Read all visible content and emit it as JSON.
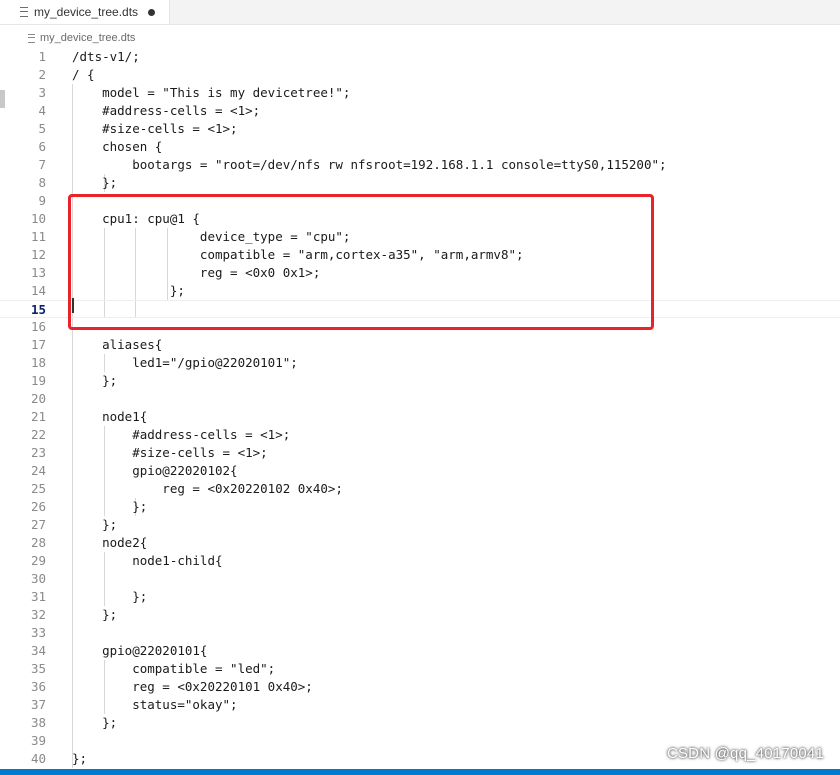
{
  "tab": {
    "filename": "my_device_tree.dts"
  },
  "breadcrumb": {
    "filename": "my_device_tree.dts"
  },
  "editor": {
    "current_line": 15,
    "lines": [
      {
        "num": "1",
        "text": "/dts-v1/;"
      },
      {
        "num": "2",
        "text": "/ {"
      },
      {
        "num": "3",
        "text": "    model = \"This is my devicetree!\";"
      },
      {
        "num": "4",
        "text": "    #address-cells = <1>;"
      },
      {
        "num": "5",
        "text": "    #size-cells = <1>;"
      },
      {
        "num": "6",
        "text": "    chosen {"
      },
      {
        "num": "7",
        "text": "        bootargs = \"root=/dev/nfs rw nfsroot=192.168.1.1 console=ttyS0,115200\";"
      },
      {
        "num": "8",
        "text": "    };"
      },
      {
        "num": "9",
        "text": ""
      },
      {
        "num": "10",
        "text": "    cpu1: cpu@1 {"
      },
      {
        "num": "11",
        "text": "                 device_type = \"cpu\";"
      },
      {
        "num": "12",
        "text": "                 compatible = \"arm,cortex-a35\", \"arm,armv8\";"
      },
      {
        "num": "13",
        "text": "                 reg = <0x0 0x1>;"
      },
      {
        "num": "14",
        "text": "             };"
      },
      {
        "num": "15",
        "text": ""
      },
      {
        "num": "16",
        "text": ""
      },
      {
        "num": "17",
        "text": "    aliases{"
      },
      {
        "num": "18",
        "text": "        led1=\"/gpio@22020101\";"
      },
      {
        "num": "19",
        "text": "    };"
      },
      {
        "num": "20",
        "text": ""
      },
      {
        "num": "21",
        "text": "    node1{"
      },
      {
        "num": "22",
        "text": "        #address-cells = <1>;"
      },
      {
        "num": "23",
        "text": "        #size-cells = <1>;"
      },
      {
        "num": "24",
        "text": "        gpio@22020102{"
      },
      {
        "num": "25",
        "text": "            reg = <0x20220102 0x40>;"
      },
      {
        "num": "26",
        "text": "        };"
      },
      {
        "num": "27",
        "text": "    };"
      },
      {
        "num": "28",
        "text": "    node2{"
      },
      {
        "num": "29",
        "text": "        node1-child{"
      },
      {
        "num": "30",
        "text": ""
      },
      {
        "num": "31",
        "text": "        };"
      },
      {
        "num": "32",
        "text": "    };"
      },
      {
        "num": "33",
        "text": ""
      },
      {
        "num": "34",
        "text": "    gpio@22020101{"
      },
      {
        "num": "35",
        "text": "        compatible = \"led\";"
      },
      {
        "num": "36",
        "text": "        reg = <0x20220101 0x40>;"
      },
      {
        "num": "37",
        "text": "        status=\"okay\";"
      },
      {
        "num": "38",
        "text": "    };"
      },
      {
        "num": "39",
        "text": ""
      },
      {
        "num": "40",
        "text": "};"
      }
    ]
  },
  "watermark": "CSDN @qq_40170041",
  "colors": {
    "highlight_box": "#e8232a",
    "statusbar": "#007acc"
  }
}
